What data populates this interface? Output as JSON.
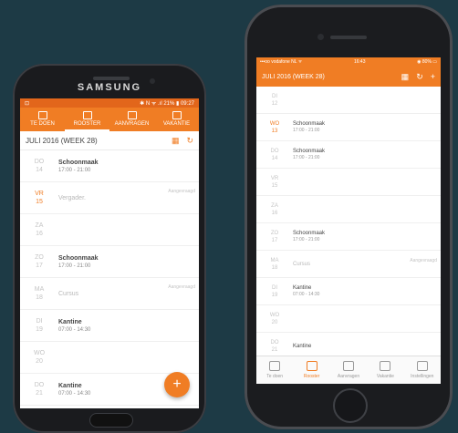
{
  "samsung": {
    "brand": "SAMSUNG",
    "status": {
      "left": "⊡",
      "right": "✱ N ᯤ .ıl 21% ▮ 09:27"
    },
    "tabs": [
      {
        "label": "TE DOEN",
        "active": false
      },
      {
        "label": "ROOSTER",
        "active": true
      },
      {
        "label": "AANVRAGEN",
        "active": false
      },
      {
        "label": "VAKANTIE",
        "active": false
      }
    ],
    "week_title": "JULI 2016 (WEEK 28)",
    "rows": [
      {
        "day": "DO",
        "date": "14",
        "title": "Schoonmaak",
        "time": "17:00 - 21:00",
        "today": false,
        "muted": false,
        "badge": ""
      },
      {
        "day": "VR",
        "date": "15",
        "title": "Vergader.",
        "time": "",
        "today": true,
        "muted": true,
        "badge": "Aangevraagd"
      },
      {
        "day": "ZA",
        "date": "16",
        "title": "",
        "time": "",
        "today": false,
        "muted": false,
        "badge": ""
      },
      {
        "day": "ZO",
        "date": "17",
        "title": "Schoonmaak",
        "time": "17:00 - 21:00",
        "today": false,
        "muted": false,
        "badge": ""
      },
      {
        "day": "MA",
        "date": "18",
        "title": "Cursus",
        "time": "",
        "today": false,
        "muted": true,
        "badge": "Aangevraagd"
      },
      {
        "day": "DI",
        "date": "19",
        "title": "Kantine",
        "time": "07:00 - 14:30",
        "today": false,
        "muted": false,
        "badge": ""
      },
      {
        "day": "WO",
        "date": "20",
        "title": "",
        "time": "",
        "today": false,
        "muted": false,
        "badge": ""
      },
      {
        "day": "DO",
        "date": "21",
        "title": "Kantine",
        "time": "07:00 - 14:30",
        "today": false,
        "muted": false,
        "badge": ""
      }
    ],
    "fab": "+"
  },
  "iphone": {
    "status": {
      "left": "•••oo vodafone NL ᯤ",
      "center": "16:43",
      "right": "◉ 80% ▭"
    },
    "week_title": "JULI 2016 (WEEK 28)",
    "rows": [
      {
        "day": "DI",
        "date": "12",
        "title": "",
        "time": "",
        "today": false,
        "muted": false,
        "badge": ""
      },
      {
        "day": "WO",
        "date": "13",
        "title": "Schoonmaak",
        "time": "17:00 - 21:00",
        "today": true,
        "muted": false,
        "badge": ""
      },
      {
        "day": "DO",
        "date": "14",
        "title": "Schoonmaak",
        "time": "17:00 - 21:00",
        "today": false,
        "muted": false,
        "badge": ""
      },
      {
        "day": "VR",
        "date": "15",
        "title": "",
        "time": "",
        "today": false,
        "muted": false,
        "badge": ""
      },
      {
        "day": "ZA",
        "date": "16",
        "title": "",
        "time": "",
        "today": false,
        "muted": false,
        "badge": ""
      },
      {
        "day": "ZO",
        "date": "17",
        "title": "Schoonmaak",
        "time": "17:00 - 21:00",
        "today": false,
        "muted": false,
        "badge": ""
      },
      {
        "day": "MA",
        "date": "18",
        "title": "Cursus",
        "time": "",
        "today": false,
        "muted": true,
        "badge": "Aangevraagd"
      },
      {
        "day": "DI",
        "date": "19",
        "title": "Kantine",
        "time": "07:00 - 14:30",
        "today": false,
        "muted": false,
        "badge": ""
      },
      {
        "day": "WO",
        "date": "20",
        "title": "",
        "time": "",
        "today": false,
        "muted": false,
        "badge": ""
      },
      {
        "day": "DO",
        "date": "21",
        "title": "Kantine",
        "time": "",
        "today": false,
        "muted": false,
        "badge": ""
      }
    ],
    "tabs": [
      {
        "label": "Te doen",
        "active": false
      },
      {
        "label": "Rooster",
        "active": true
      },
      {
        "label": "Aanvragen",
        "active": false
      },
      {
        "label": "Vakantie",
        "active": false
      },
      {
        "label": "Instellingen",
        "active": false
      }
    ]
  },
  "colors": {
    "accent": "#f07d24",
    "background": "#1d3a45"
  }
}
